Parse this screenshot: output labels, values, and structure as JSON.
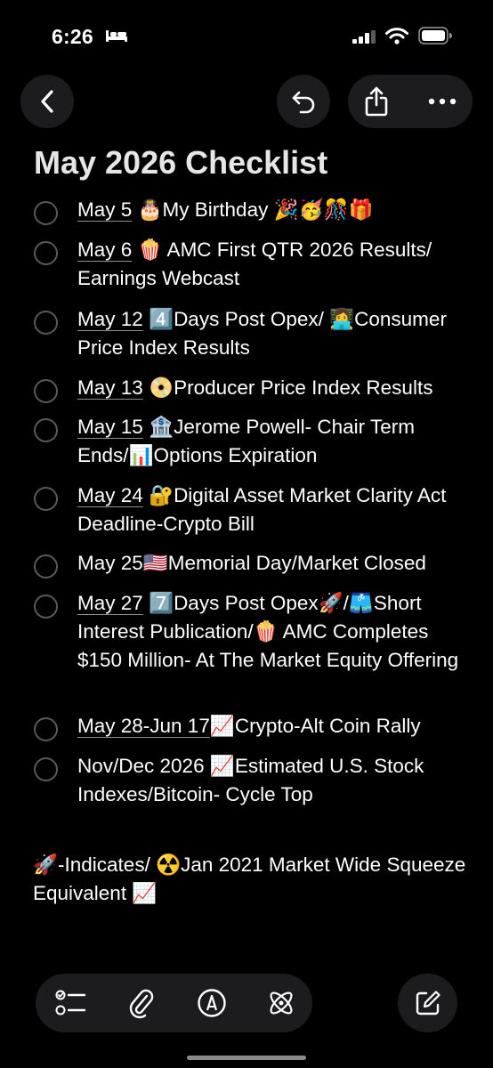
{
  "status": {
    "time": "6:26"
  },
  "note": {
    "title": "May 2026 Checklist"
  },
  "checklist": [
    {
      "date": "May 5",
      "text": " 🎂My Birthday 🎉🥳🎊🎁"
    },
    {
      "date": "May 6",
      "text": " 🍿 AMC First QTR 2026 Results/ Earnings Webcast"
    },
    {
      "date": "May 12",
      "text": " 4️⃣Days Post Opex/ 👩‍💻Consumer Price Index Results"
    },
    {
      "date": "May 13",
      "text": " 📀Producer Price Index Results"
    },
    {
      "date": "May 15",
      "text": " 🏦Jerome Powell- Chair Term Ends/📊Options Expiration"
    },
    {
      "date": "May 24",
      "text": " 🔐Digital Asset Market Clarity Act Deadline-Crypto Bill"
    },
    {
      "date": "",
      "text": "May 25🇺🇸Memorial Day/Market Closed"
    },
    {
      "date": "May 27",
      "text": " 7️⃣Days Post Opex🚀/🩳Short Interest Publication/🍿 AMC Completes $150 Million- At The Market Equity Offering"
    },
    {
      "date": "May 28-Jun 17",
      "text": "📈Crypto-Alt Coin Rally"
    },
    {
      "date": "",
      "text": "Nov/Dec 2026 📈Estimated U.S. Stock Indexes/Bitcoin- Cycle Top"
    }
  ],
  "footer": {
    "text": "🚀-Indicates/ ☢️Jan 2021 Market Wide Squeeze Equivalent 📈"
  },
  "icons": {
    "status": [
      "bed-icon",
      "signal-icon",
      "wifi-icon",
      "battery-icon"
    ],
    "header": [
      "chevron-left-icon",
      "undo-icon",
      "share-icon",
      "ellipsis-icon"
    ],
    "toolbar": [
      "checklist-icon",
      "paperclip-icon",
      "markup-pen-icon",
      "apple-intelligence-icon",
      "compose-icon"
    ]
  }
}
